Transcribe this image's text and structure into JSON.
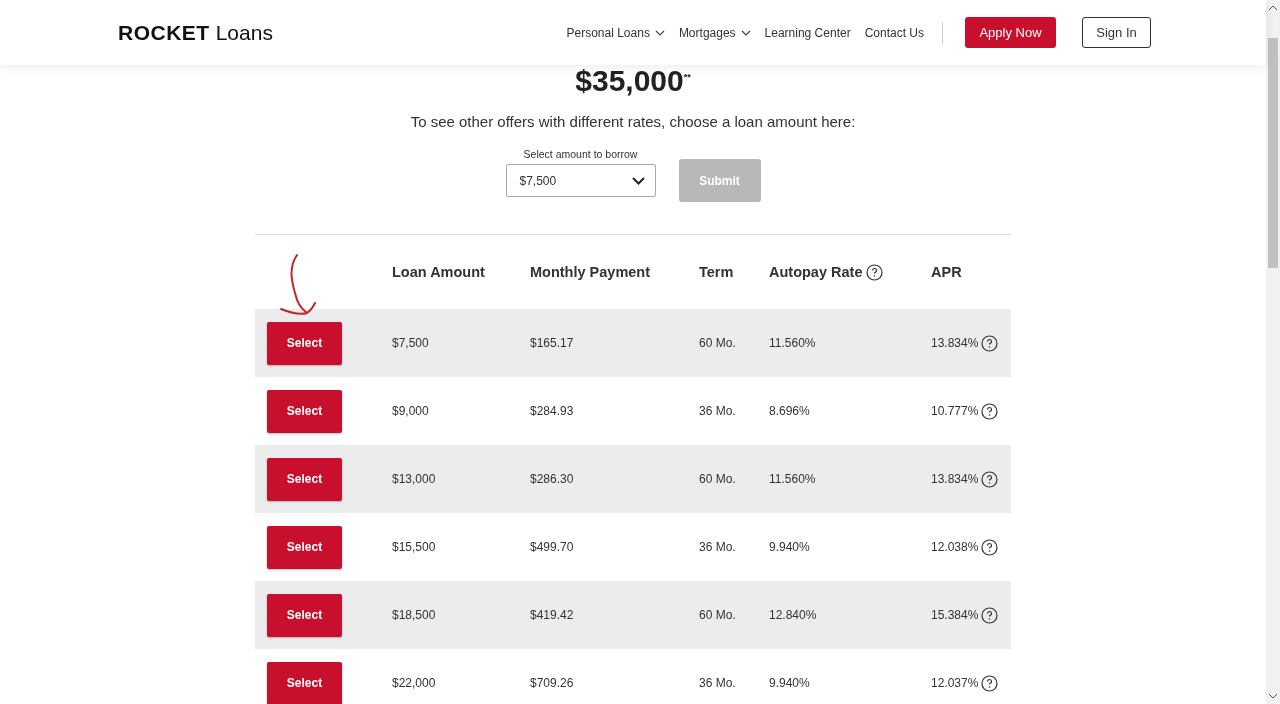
{
  "header": {
    "logo": {
      "brand": "ROCKET",
      "product": "Loans"
    },
    "nav": [
      {
        "label": "Personal Loans",
        "dropdown": true
      },
      {
        "label": "Mortgages",
        "dropdown": true
      },
      {
        "label": "Learning Center",
        "dropdown": false
      },
      {
        "label": "Contact Us",
        "dropdown": false
      }
    ],
    "apply_button": "Apply Now",
    "sign_in_button": "Sign In"
  },
  "offer": {
    "amount": "$35,000$^{**}$",
    "prompt": "To see other offers with different rates, choose a loan amount here:",
    "select_label": "Select amount to borrow",
    "select_value": "$7,500",
    "submit": {
      "label": "Submit",
      "disabled": true
    }
  },
  "table": {
    "columns": [
      "Loan Amount",
      "Monthly Payment",
      "Term",
      "Autopay Rate",
      "APR"
    ],
    "rows": [
      {
        "button": "Select",
        "amount": "$7,500",
        "payment": "$165.17",
        "term": "60 Mo.",
        "autopay": "11.560%",
        "apr": "13.834%",
        "shaded": true
      },
      {
        "button": "Select",
        "amount": "$9,000",
        "payment": "$284.93",
        "term": "36 Mo.",
        "autopay": "8.696%",
        "apr": "10.777%",
        "shaded": false
      },
      {
        "button": "Select",
        "amount": "$13,000",
        "payment": "$286.30",
        "term": "60 Mo.",
        "autopay": "11.560%",
        "apr": "13.834%",
        "shaded": true
      },
      {
        "button": "Select",
        "amount": "$15,500",
        "payment": "$499.70",
        "term": "36 Mo.",
        "autopay": "9.940%",
        "apr": "12.038%",
        "shaded": false
      },
      {
        "button": "Select",
        "amount": "$18,500",
        "payment": "$419.42",
        "term": "60 Mo.",
        "autopay": "12.840%",
        "apr": "15.384%",
        "shaded": true
      },
      {
        "button": "Select",
        "amount": "$22,000",
        "payment": "$709.26",
        "term": "36 Mo.",
        "autopay": "9.940%",
        "apr": "12.037%",
        "shaded": false
      }
    ]
  }
}
